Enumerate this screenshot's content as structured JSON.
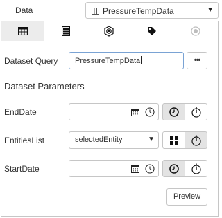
{
  "header": {
    "label": "Data",
    "dataset_selected": "PressureTempData",
    "icons": {
      "table": "table-icon",
      "caret": "chevron-down-icon"
    }
  },
  "tabs": [
    {
      "icon": "table-icon",
      "active": true
    },
    {
      "icon": "calculator-icon",
      "active": false
    },
    {
      "icon": "gear-icon",
      "active": false
    },
    {
      "icon": "tag-icon",
      "active": false
    },
    {
      "icon": "radio-icon",
      "active": false,
      "disabled": true
    }
  ],
  "query": {
    "label": "Dataset Query",
    "value": "PressureTempData",
    "more_label": "•••"
  },
  "parameters": {
    "heading": "Dataset Parameters",
    "items": [
      {
        "label": "EndDate",
        "value": "",
        "type": "date",
        "icons": [
          "calendar-icon",
          "clock-icon"
        ],
        "buttons": [
          "clock-button",
          "timer-button"
        ]
      },
      {
        "label": "EntitiesList",
        "value": "selectedEntity",
        "type": "select",
        "icons": [
          "chevron-down-icon"
        ],
        "buttons": [
          "grid-button",
          "timer-button"
        ]
      },
      {
        "label": "StartDate",
        "value": "",
        "type": "date",
        "icons": [
          "calendar-icon",
          "clock-icon"
        ],
        "buttons": [
          "clock-button",
          "timer-button"
        ]
      }
    ]
  },
  "preview_label": "Preview",
  "colors": {
    "border": "#c6c6c6",
    "focus_border": "#7aa3d4",
    "active_tab_bg": "#ececec",
    "pressed_bg": "#e3e3e3"
  }
}
